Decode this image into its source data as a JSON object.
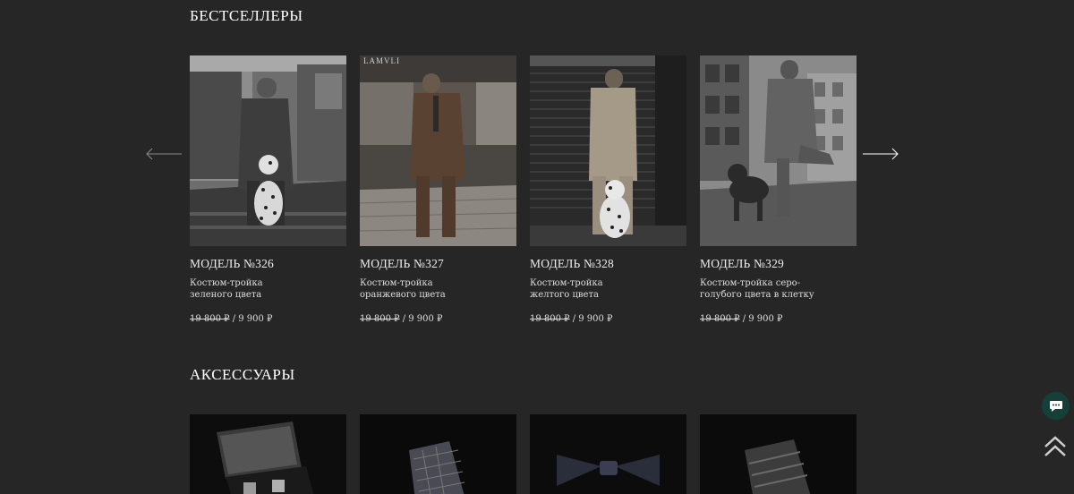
{
  "bestsellers": {
    "title": "БЕСТСЕЛЛЕРЫ",
    "products": [
      {
        "model": "МОДЕЛЬ №326",
        "description": "Костюм-тройка зеленого цвета",
        "old_price": "19 800 ₽",
        "separator": " / ",
        "price": "9 900 ₽"
      },
      {
        "model": "МОДЕЛЬ №327",
        "description": "Костюм-тройка оранжевого цвета",
        "old_price": "19 800 ₽",
        "separator": " / ",
        "price": "9 900 ₽"
      },
      {
        "model": "МОДЕЛЬ №328",
        "description": "Костюм-тройка желтого цвета",
        "old_price": "19 800 ₽",
        "separator": " / ",
        "price": "9 900 ₽"
      },
      {
        "model": "МОДЕЛЬ №329",
        "description": "Костюм-тройка серо-голубого цвета в клетку",
        "old_price": "19 800 ₽",
        "separator": " / ",
        "price": "9 900 ₽"
      }
    ]
  },
  "accessories": {
    "title": "АКСЕССУАРЫ"
  },
  "photo_signs": {
    "restaurant": "LAMVLI"
  },
  "icons": {
    "prev": "arrow-left-icon",
    "next": "arrow-right-icon",
    "chat": "chat-bubble-icon",
    "scroll_up": "double-chevron-up-icon"
  },
  "colors": {
    "background": "#262626",
    "text": "#ffffff",
    "chat_button": "#15403a"
  }
}
